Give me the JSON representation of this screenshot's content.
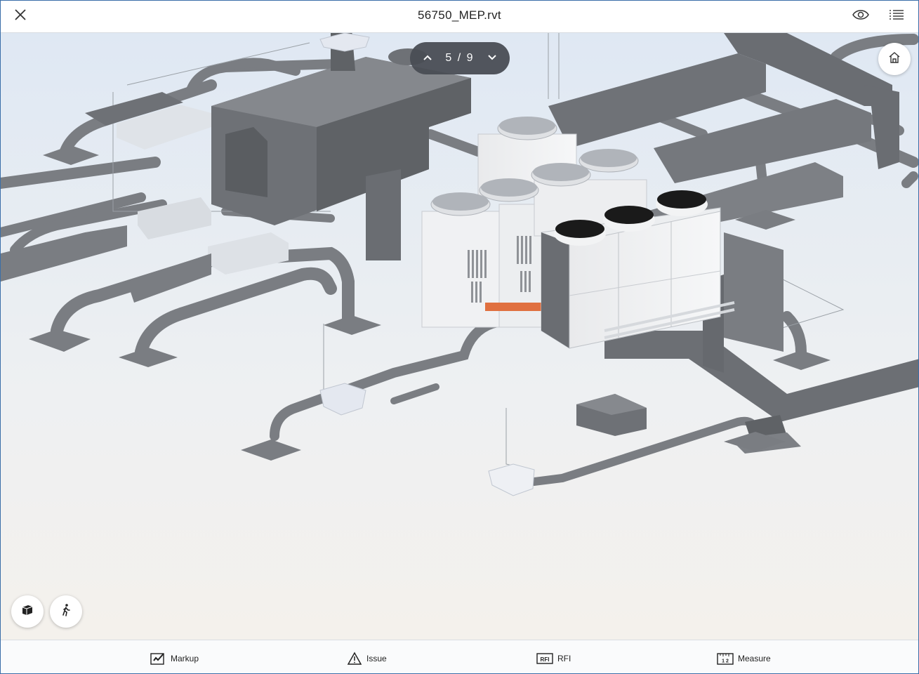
{
  "header": {
    "title": "56750_MEP.rvt",
    "close_icon": "close-icon",
    "visibility_icon": "eye-icon",
    "menu_icon": "list-icon"
  },
  "view_navigator": {
    "counter": "5 / 9",
    "prev_icon": "chevron-up-icon",
    "next_icon": "chevron-down-icon"
  },
  "floating_buttons": {
    "home_icon": "home-icon",
    "model_icon": "cube-icon",
    "walk_icon": "walk-icon"
  },
  "toolbar": {
    "items": [
      {
        "label": "Markup",
        "icon": "markup-icon"
      },
      {
        "label": "Issue",
        "icon": "warning-triangle-icon"
      },
      {
        "label": "RFI",
        "icon": "rfi-icon"
      },
      {
        "label": "Measure",
        "icon": "ruler-icon"
      }
    ]
  },
  "rfi_icon_text": "RFI",
  "measure_icon_text": "1 2",
  "colors": {
    "duct": "#7a7d82",
    "duct_dark": "#5f6266",
    "unit_body": "#eceef0",
    "fan_black": "#1a1a1a",
    "accent_pipe": "#e07040"
  }
}
